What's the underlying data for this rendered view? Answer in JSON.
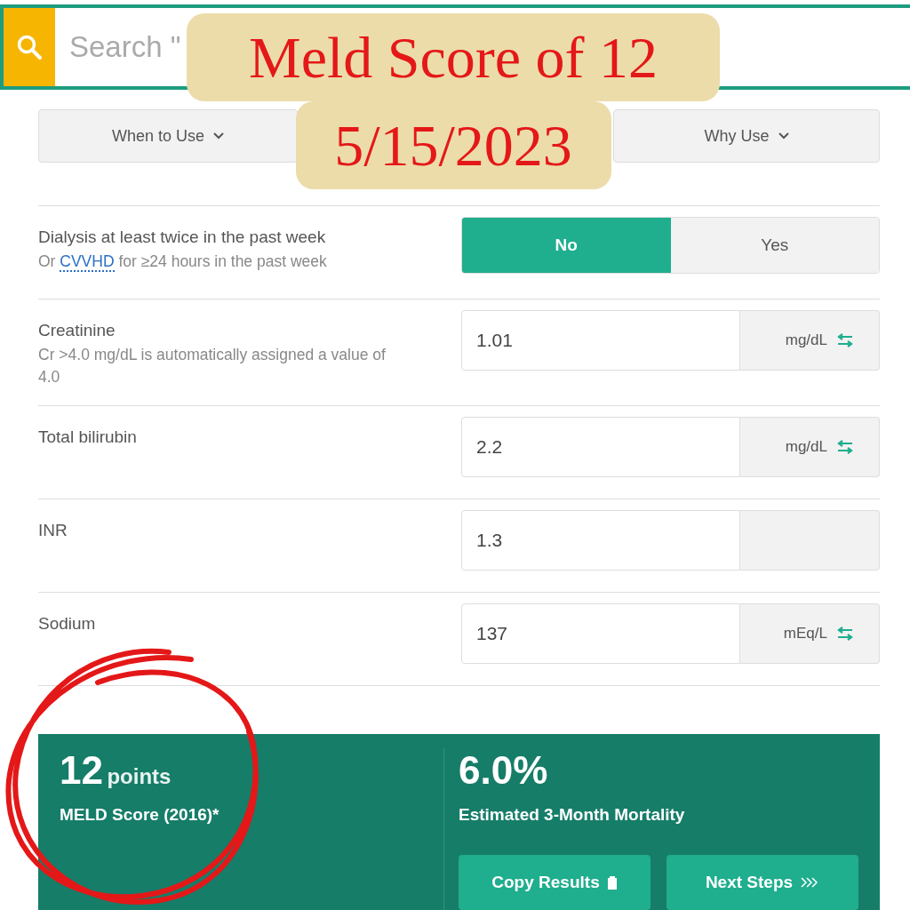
{
  "search": {
    "placeholder": "Search \""
  },
  "caption": {
    "lines": [
      "Meld Score of 12",
      "5/15/2023"
    ]
  },
  "info_tabs": [
    {
      "label": "When to Use"
    },
    {
      "label": "Why Use"
    }
  ],
  "inputs": [
    {
      "kind": "toggle",
      "label": "Dialysis at least twice in the past week",
      "hint_before": "Or ",
      "hint_link": "CVVHD",
      "hint_after": " for ≥24 hours in the past week",
      "options": [
        {
          "label": "No",
          "selected": true
        },
        {
          "label": "Yes",
          "selected": false
        }
      ]
    },
    {
      "kind": "number",
      "label": "Creatinine",
      "hint": "Cr >4.0 mg/dL is automatically assigned a value of 4.0",
      "value": "1.01",
      "unit": "mg/dL"
    },
    {
      "kind": "number",
      "label": "Total bilirubin",
      "value": "2.2",
      "unit": "mg/dL"
    },
    {
      "kind": "number",
      "label": "INR",
      "value": "1.3"
    },
    {
      "kind": "number",
      "label": "Sodium",
      "value": "137",
      "unit": "mEq/L"
    }
  ],
  "result": {
    "score": "12",
    "score_unit": "points",
    "score_label": "MELD Score (2016)*",
    "mortality": "6.0%",
    "mortality_label": "Estimated 3-Month Mortality",
    "buttons": [
      {
        "kind": "copy",
        "label": "Copy Results"
      },
      {
        "kind": "next",
        "label": "Next Steps"
      }
    ]
  }
}
